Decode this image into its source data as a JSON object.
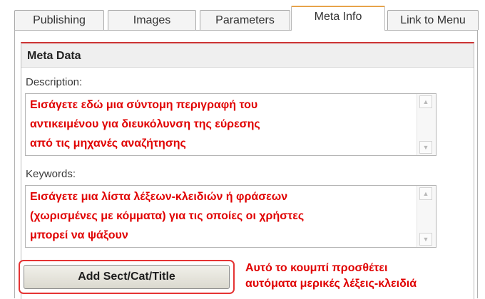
{
  "tabs": [
    {
      "label": "Publishing",
      "active": false
    },
    {
      "label": "Images",
      "active": false
    },
    {
      "label": "Parameters",
      "active": false
    },
    {
      "label": "Meta Info",
      "active": true
    },
    {
      "label": "Link to Menu",
      "active": false
    }
  ],
  "meta": {
    "title": "Meta Data",
    "description": {
      "label": "Description:",
      "lines": [
        "Εισάγετε εδώ μια σύντομη περιγραφή του",
        "αντικειμένου για διευκόλυνση της εύρεσης",
        "από τις μηχανές αναζήτησης"
      ]
    },
    "keywords": {
      "label": "Keywords:",
      "lines": [
        "Εισάγετε μια λίστα λέξεων-κλειδιών ή φράσεων",
        "(χωρισμένες με κόμματα) για τις οποίες οι χρήστες",
        "μπορεί να ψάξουν"
      ]
    }
  },
  "button": {
    "label": "Add Sect/Cat/Title"
  },
  "annotation": {
    "lines": [
      "Αυτό το κουμπί προσθέτει",
      "αυτόματα μερικές λέξεις-κλειδιά"
    ]
  },
  "colors": {
    "highlight": "#e53434",
    "text_red": "#e00000",
    "active_tab_top": "#e7a34a"
  },
  "icons": {
    "scroll_up": "▲",
    "scroll_down": "▼"
  }
}
